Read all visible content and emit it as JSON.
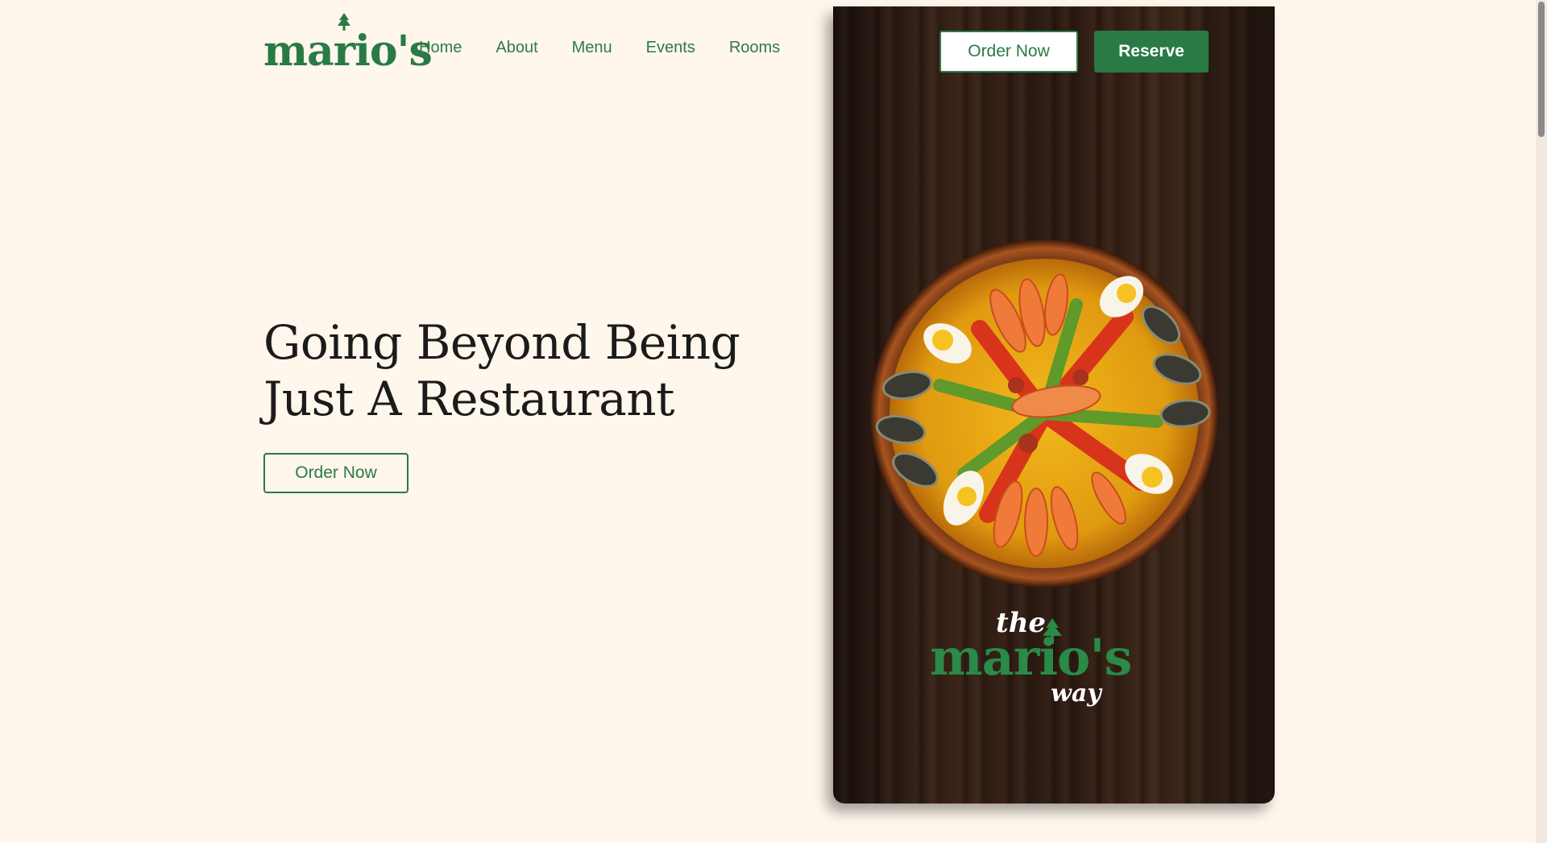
{
  "brand": {
    "logo_text": "mario's",
    "accent_color": "#2a7a46",
    "background_color": "#fff6ec"
  },
  "nav": {
    "items": [
      {
        "label": "Home"
      },
      {
        "label": "About"
      },
      {
        "label": "Menu"
      },
      {
        "label": "Events"
      },
      {
        "label": "Rooms"
      }
    ]
  },
  "hero": {
    "title": "Going Beyond Being Just A Restaurant",
    "cta_label": "Order Now"
  },
  "panel": {
    "order_label": "Order Now",
    "reserve_label": "Reserve",
    "slogan_the": "the",
    "slogan_name": "mario's",
    "slogan_way": "way",
    "image": "paella-dish"
  }
}
